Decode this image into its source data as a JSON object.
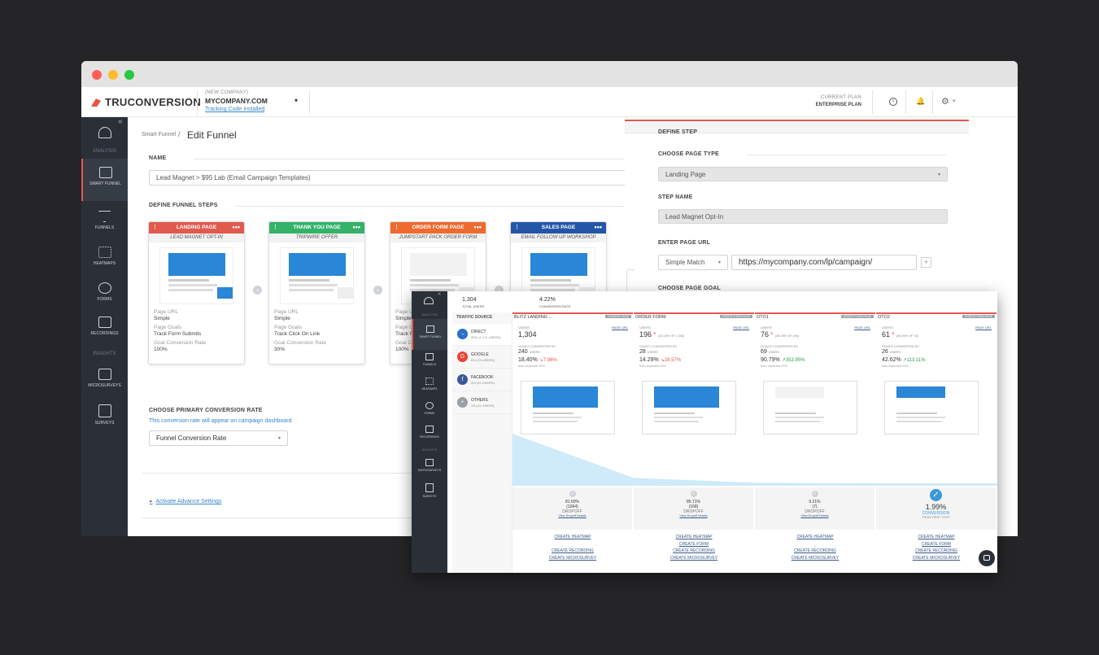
{
  "app": {
    "name": "TRUCONVERSION"
  },
  "company": {
    "tag": "(NEW COMPANY)",
    "name": "MYCOMPANY.COM",
    "tracking": "Tracking Code Installed"
  },
  "plan": {
    "label": "CURRENT PLAN",
    "value": "ENTERPRISE PLAN"
  },
  "sidebar": {
    "sections": {
      "analysis": "ANALYSIS",
      "insights": "INSIGHTS"
    },
    "items": [
      {
        "label": "",
        "icon": "dashboard-icon"
      },
      {
        "label": "SMART FUNNEL",
        "icon": "smart-funnel-icon"
      },
      {
        "label": "FUNNELS",
        "icon": "funnel-icon"
      },
      {
        "label": "HEATMAPS",
        "icon": "heatmap-icon"
      },
      {
        "label": "FORMS",
        "icon": "forms-icon"
      },
      {
        "label": "RECORDINGS",
        "icon": "video-icon"
      },
      {
        "label": "MICROSURVEYS",
        "icon": "checkbox-icon"
      },
      {
        "label": "SURVEYS",
        "icon": "clipboard-icon"
      }
    ]
  },
  "breadcrumb": {
    "parent": "Smart Funnel",
    "sep": "/",
    "title": "Edit Funnel"
  },
  "form": {
    "name_label": "NAME",
    "name_value": "Lead Magnet > $95 Lab (Email Campaign Templates)",
    "steps_label": "DEFINE FUNNEL STEPS",
    "primary_label": "CHOOSE PRIMARY CONVERSION RATE",
    "primary_hint": "This conversion rate will appear on campaign dashboard",
    "primary_value": "Funnel Conversion Rate",
    "advanced": "Activate Advance Settings"
  },
  "steps": [
    {
      "type": "LANDING PAGE",
      "name": "LEAD MAGNET OPT-IN",
      "color": "#e05a4e",
      "url_k": "Page URL",
      "url_v": "Simple",
      "goals_k": "Page Goals",
      "goals_v": "Track Form Submits",
      "rate_k": "Goal Conversion Rate",
      "rate_v": "100%"
    },
    {
      "type": "THANK YOU PAGE",
      "name": "TRIPWIRE OFFER",
      "color": "#35b26a",
      "url_k": "Page URL",
      "url_v": "Simple",
      "goals_k": "Page Goals",
      "goals_v": "Track Click On Link",
      "rate_k": "Goal Conversion Rate",
      "rate_v": "30%"
    },
    {
      "type": "ORDER FORM PAGE",
      "name": "JUMPSTART PACK ORDER FORM",
      "color": "#ef6a2f",
      "url_k": "Page U",
      "url_v": "Simple",
      "goals_k": "Page G",
      "goals_v": "Track F",
      "rate_k": "Goal C",
      "rate_v": "100%"
    },
    {
      "type": "SALES PAGE",
      "name": "EMAIL FOLLOW UP WORKSHOP",
      "color": "#2456a8",
      "url_k": "",
      "url_v": "",
      "goals_k": "",
      "goals_v": "",
      "rate_k": "",
      "rate_v": ""
    }
  ],
  "panel": {
    "title": "DEFINE STEP",
    "type_label": "CHOOSE PAGE TYPE",
    "type_value": "Landing Page",
    "name_label": "STEP NAME",
    "name_value": "Lead Magnet Opt-In",
    "url_label": "ENTER PAGE URL",
    "match_value": "Simple Match",
    "url_value": "https://mycompany.com/lp/campaign/",
    "goal_label": "CHOOSE PAGE GOAL"
  },
  "report": {
    "total_users": "1,304",
    "total_users_label": "TOTAL USERS",
    "conv_rate": "4.22%",
    "conv_rate_label": "CONVERSION RATE",
    "traffic_label": "TRAFFIC SOURCE",
    "sources": [
      {
        "name": "DIRECT",
        "detail": "90% (1,171 USERS)",
        "color": "#2a6fc9"
      },
      {
        "name": "GOOGLE",
        "detail": "6% (78 USERS)",
        "color": "#ea4335"
      },
      {
        "name": "FACEBOOK",
        "detail": "3% (42 USERS)",
        "color": "#3b5998"
      },
      {
        "name": "OTHERS",
        "detail": "1% (11 USERS)",
        "color": "#9aa0a6"
      }
    ],
    "columns": [
      {
        "title": "BLITZ LANDING ...",
        "badge": "LANDING PAGE",
        "users": "1,304",
        "users_extra": "",
        "conv": "240",
        "rate": "18.40%",
        "delta": "7.98%",
        "delta_dir": "down",
        "expected": "from expected 20%",
        "drop_pct": "81.60%",
        "drop_n": "(1064)",
        "drop_label": "DROPOFF",
        "drop_link": "View Dropoff Details",
        "links": [
          "CREATE HEATMAP",
          "",
          "CREATE RECORDING",
          "CREATE MICROSURVEY"
        ]
      },
      {
        "title": "ORDER FORM",
        "badge": "ORDER FORM PAGE",
        "users": "196",
        "users_extra": "(15.03% OF 1,304)",
        "conv": "28",
        "rate": "14.29%",
        "delta": "28.57%",
        "delta_dir": "down",
        "expected": "from expected 20%",
        "drop_pct": "85.71%",
        "drop_n": "(168)",
        "drop_label": "DROPOFF",
        "drop_link": "View Dropoff Details",
        "links": [
          "CREATE HEATMAP",
          "CREATE FORM",
          "CREATE RECORDING",
          "CREATE MICROSURVEY"
        ]
      },
      {
        "title": "OTO1",
        "badge": "ORDER FORM PAGE",
        "users": "76",
        "users_extra": "(38.78% OF 196)",
        "conv": "69",
        "rate": "90.79%",
        "delta": "353.95%",
        "delta_dir": "up",
        "expected": "from expected 20%",
        "drop_pct": "9.21%",
        "drop_n": "(7)",
        "drop_label": "DROPOFF",
        "drop_link": "View Dropoff Details",
        "links": [
          "CREATE HEATMAP",
          "",
          "CREATE RECORDING",
          "CREATE MICROSURVEY"
        ]
      },
      {
        "title": "OTO2",
        "badge": "ORDER FORM PAGE",
        "users": "61",
        "users_extra": "(80.26% OF 76)",
        "conv": "26",
        "rate": "42.62%",
        "delta": "113.11%",
        "delta_dir": "up",
        "expected": "from expected 20%",
        "drop_pct": "1.99%",
        "drop_n": "",
        "drop_label": "CONVERSION",
        "drop_link": "FROM FIRST STEP",
        "links": [
          "CREATE HEATMAP",
          "CREATE FORM",
          "CREATE RECORDING",
          "CREATE MICROSURVEY"
        ]
      }
    ],
    "col_labels": {
      "users": "USERS",
      "page_url": "PAGE URL",
      "goals": "GOALS CONVERTED BY",
      "users_small": "USERS"
    },
    "funnel_users": [
      1304,
      196,
      76,
      61
    ]
  }
}
